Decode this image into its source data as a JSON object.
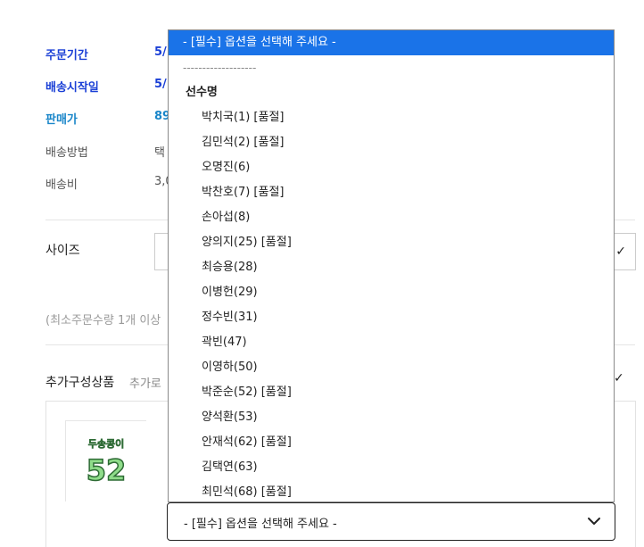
{
  "info": {
    "period_label": "주문기간",
    "period_value": "5/",
    "ship_start_label": "배송시작일",
    "ship_start_value": "5/",
    "price_label": "판매가",
    "price_value": "89",
    "ship_method_label": "배송방법",
    "ship_method_value": "택",
    "ship_fee_label": "배송비",
    "ship_fee_value": "3,0"
  },
  "size": {
    "label": "사이즈"
  },
  "min_order_note": "(최소주문수량 1개 이상",
  "addon": {
    "title": "추가구성상품",
    "subtitle": "추가로"
  },
  "dropdown": {
    "selected": "- [필수] 옵션을 선택해 주세요 -",
    "separator": "-------------------",
    "group_label": "선수명",
    "options": [
      "박치국(1) [품절]",
      "김민석(2) [품절]",
      "오명진(6)",
      "박찬호(7) [품절]",
      "손아섭(8)",
      "양의지(25) [품절]",
      "최승용(28)",
      "이병헌(29)",
      "정수빈(31)",
      "곽빈(47)",
      "이영하(50)",
      "박준순(52) [품절]",
      "양석환(53)",
      "안재석(62) [품절]",
      "김택연(63)",
      "최민석(68) [품절]"
    ]
  },
  "bottom_select": {
    "value": "- [필수] 옵션을 선택해 주세요 -"
  },
  "thumbnail": {
    "logo_text": "두송콩이",
    "number_text": "52"
  },
  "colors": {
    "highlight": "#1a73e8",
    "label_blue": "#1a3fd6",
    "price_blue": "#1a86c9"
  }
}
